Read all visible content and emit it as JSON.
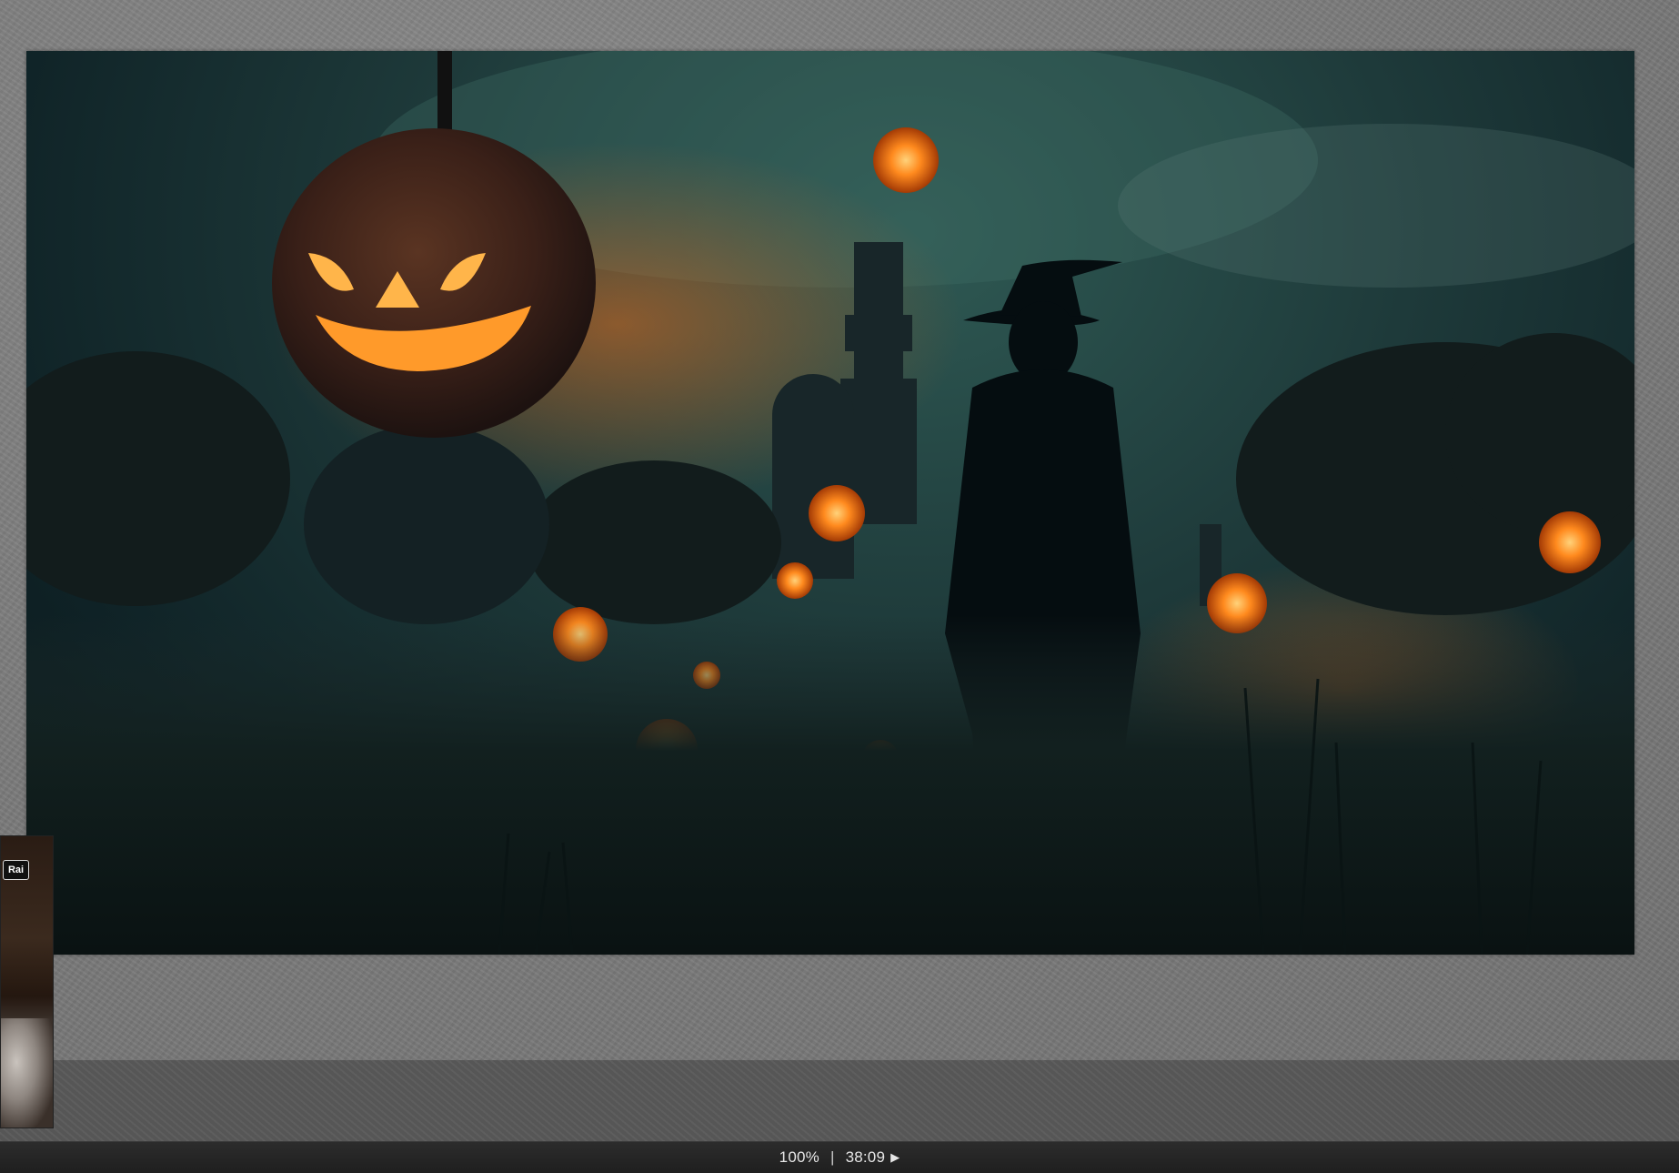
{
  "viewer": {
    "zoom": "100%",
    "separator": "|",
    "time": "38:09",
    "play_icon": "play-icon"
  },
  "artwork": {
    "description_icon": "image"
  },
  "thumbnail": {
    "logo_text": "Rai"
  },
  "colors": {
    "status_bar_bg": "#252525",
    "stage_bg": "#7f7f7f",
    "lower_band_bg": "#595959",
    "pumpkin_glow": "#ff8a1e"
  }
}
